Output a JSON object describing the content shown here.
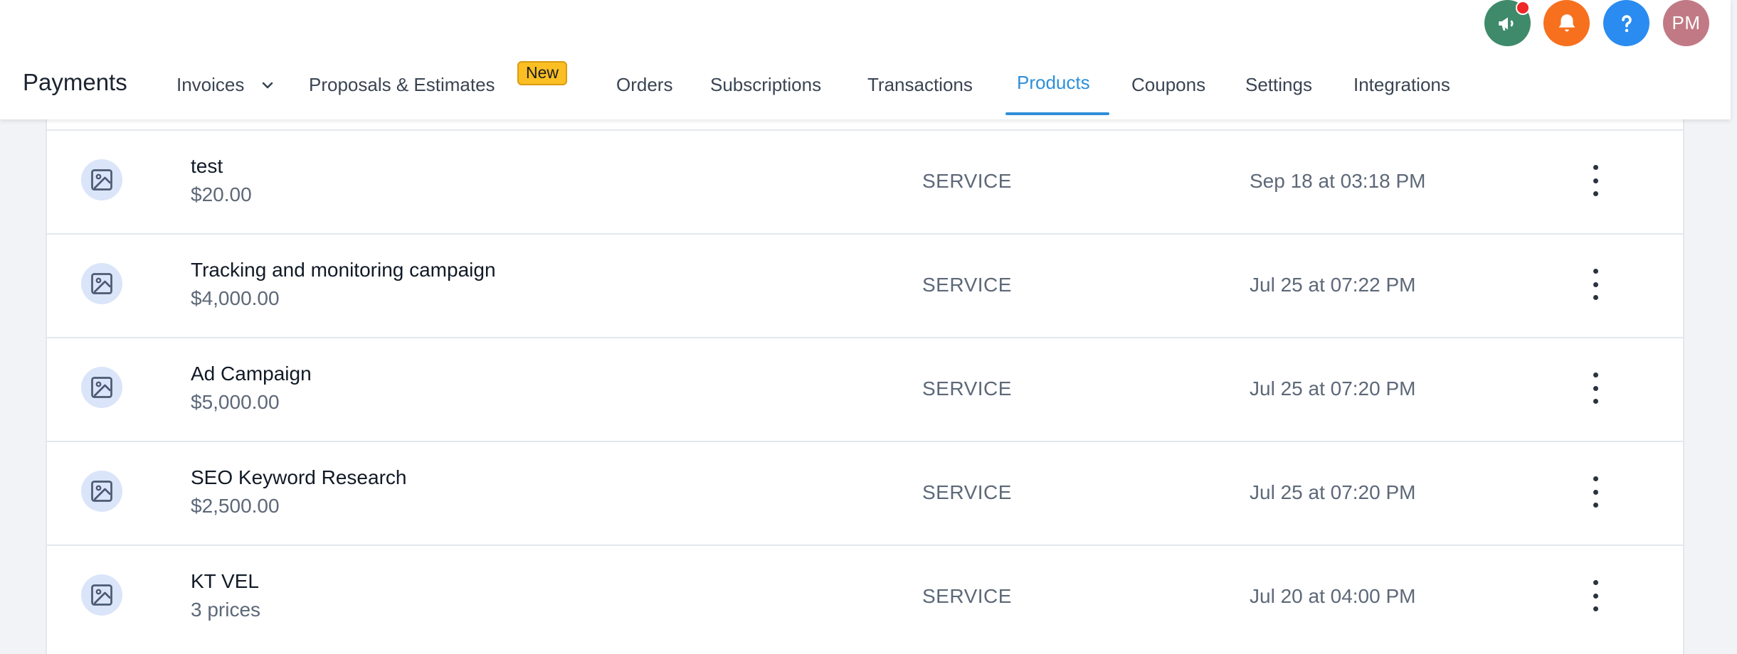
{
  "app": {
    "title": "Payments"
  },
  "top_actions": {
    "announcements_icon": "megaphone-icon",
    "notifications_icon": "bell-icon",
    "help_icon": "question-icon",
    "avatar_initials": "PM",
    "colors": {
      "announcements": "#3f8a6a",
      "notifications": "#f7701e",
      "help": "#2a8cf0",
      "avatar": "#c17a85",
      "unread_dot": "#ee2727"
    }
  },
  "nav": {
    "invoices": "Invoices",
    "proposals": "Proposals & Estimates",
    "proposals_badge": "New",
    "orders": "Orders",
    "subscriptions": "Subscriptions",
    "transactions": "Transactions",
    "products": "Products",
    "coupons": "Coupons",
    "settings": "Settings",
    "integrations": "Integrations",
    "active_tab": "Products",
    "active_color": "#2f8fd8"
  },
  "products": [
    {
      "name": "test",
      "price": "$20.00",
      "type": "SERVICE",
      "date": "Sep 18 at 03:18 PM"
    },
    {
      "name": "Tracking and monitoring campaign",
      "price": "$4,000.00",
      "type": "SERVICE",
      "date": "Jul 25 at 07:22 PM"
    },
    {
      "name": "Ad Campaign",
      "price": "$5,000.00",
      "type": "SERVICE",
      "date": "Jul 25 at 07:20 PM"
    },
    {
      "name": "SEO Keyword Research",
      "price": "$2,500.00",
      "type": "SERVICE",
      "date": "Jul 25 at 07:20 PM"
    },
    {
      "name": "KT VEL",
      "price": "3 prices",
      "type": "SERVICE",
      "date": "Jul 20 at 04:00 PM"
    }
  ]
}
